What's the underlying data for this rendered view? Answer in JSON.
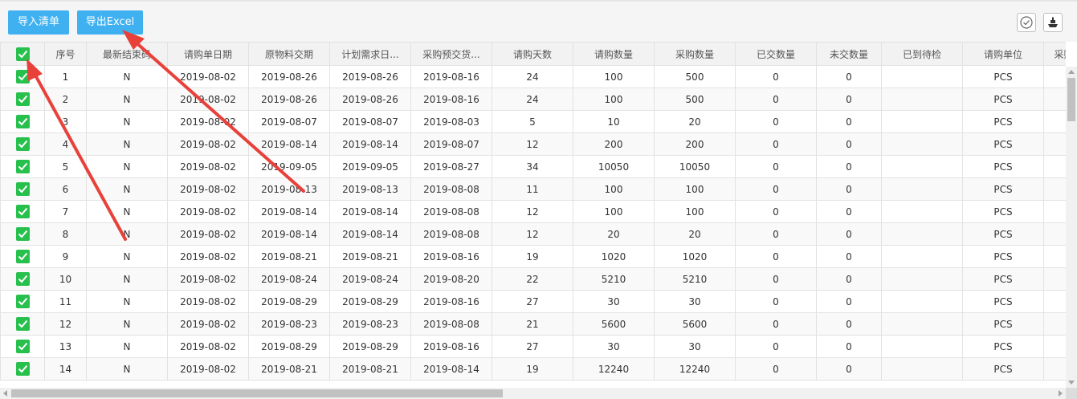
{
  "toolbar": {
    "import_label": "导入清单",
    "export_label": "导出Excel",
    "check_icon": "circle-check-icon",
    "tool_icon": "boat-tool-icon"
  },
  "colors": {
    "button": "#3fb1f1",
    "checkbox": "#27c04d",
    "arrow": "#e8413a"
  },
  "table": {
    "columns": [
      "序号",
      "最新结束码",
      "请购单日期",
      "原物料交期",
      "计划需求日...",
      "采购预交货...",
      "请购天数",
      "请购数量",
      "采购数量",
      "已交数量",
      "未交数量",
      "已到待检",
      "请购单位",
      "采购"
    ],
    "rows": [
      [
        "1",
        "N",
        "2019-08-02",
        "2019-08-26",
        "2019-08-26",
        "2019-08-16",
        "24",
        "100",
        "500",
        "0",
        "0",
        "",
        "PCS",
        ""
      ],
      [
        "2",
        "N",
        "2019-08-02",
        "2019-08-26",
        "2019-08-26",
        "2019-08-16",
        "24",
        "100",
        "500",
        "0",
        "0",
        "",
        "PCS",
        ""
      ],
      [
        "3",
        "N",
        "2019-08-02",
        "2019-08-07",
        "2019-08-07",
        "2019-08-03",
        "5",
        "10",
        "20",
        "0",
        "0",
        "",
        "PCS",
        ""
      ],
      [
        "4",
        "N",
        "2019-08-02",
        "2019-08-14",
        "2019-08-14",
        "2019-08-07",
        "12",
        "200",
        "200",
        "0",
        "0",
        "",
        "PCS",
        ""
      ],
      [
        "5",
        "N",
        "2019-08-02",
        "2019-09-05",
        "2019-09-05",
        "2019-08-27",
        "34",
        "10050",
        "10050",
        "0",
        "0",
        "",
        "PCS",
        ""
      ],
      [
        "6",
        "N",
        "2019-08-02",
        "2019-08-13",
        "2019-08-13",
        "2019-08-08",
        "11",
        "100",
        "100",
        "0",
        "0",
        "",
        "PCS",
        ""
      ],
      [
        "7",
        "N",
        "2019-08-02",
        "2019-08-14",
        "2019-08-14",
        "2019-08-08",
        "12",
        "100",
        "100",
        "0",
        "0",
        "",
        "PCS",
        ""
      ],
      [
        "8",
        "N",
        "2019-08-02",
        "2019-08-14",
        "2019-08-14",
        "2019-08-08",
        "12",
        "20",
        "20",
        "0",
        "0",
        "",
        "PCS",
        ""
      ],
      [
        "9",
        "N",
        "2019-08-02",
        "2019-08-21",
        "2019-08-21",
        "2019-08-16",
        "19",
        "1020",
        "1020",
        "0",
        "0",
        "",
        "PCS",
        ""
      ],
      [
        "10",
        "N",
        "2019-08-02",
        "2019-08-24",
        "2019-08-24",
        "2019-08-20",
        "22",
        "5210",
        "5210",
        "0",
        "0",
        "",
        "PCS",
        ""
      ],
      [
        "11",
        "N",
        "2019-08-02",
        "2019-08-29",
        "2019-08-29",
        "2019-08-16",
        "27",
        "30",
        "30",
        "0",
        "0",
        "",
        "PCS",
        ""
      ],
      [
        "12",
        "N",
        "2019-08-02",
        "2019-08-23",
        "2019-08-23",
        "2019-08-08",
        "21",
        "5600",
        "5600",
        "0",
        "0",
        "",
        "PCS",
        ""
      ],
      [
        "13",
        "N",
        "2019-08-02",
        "2019-08-29",
        "2019-08-29",
        "2019-08-16",
        "27",
        "30",
        "30",
        "0",
        "0",
        "",
        "PCS",
        ""
      ],
      [
        "14",
        "N",
        "2019-08-02",
        "2019-08-21",
        "2019-08-21",
        "2019-08-14",
        "19",
        "12240",
        "12240",
        "0",
        "0",
        "",
        "PCS",
        ""
      ]
    ]
  }
}
